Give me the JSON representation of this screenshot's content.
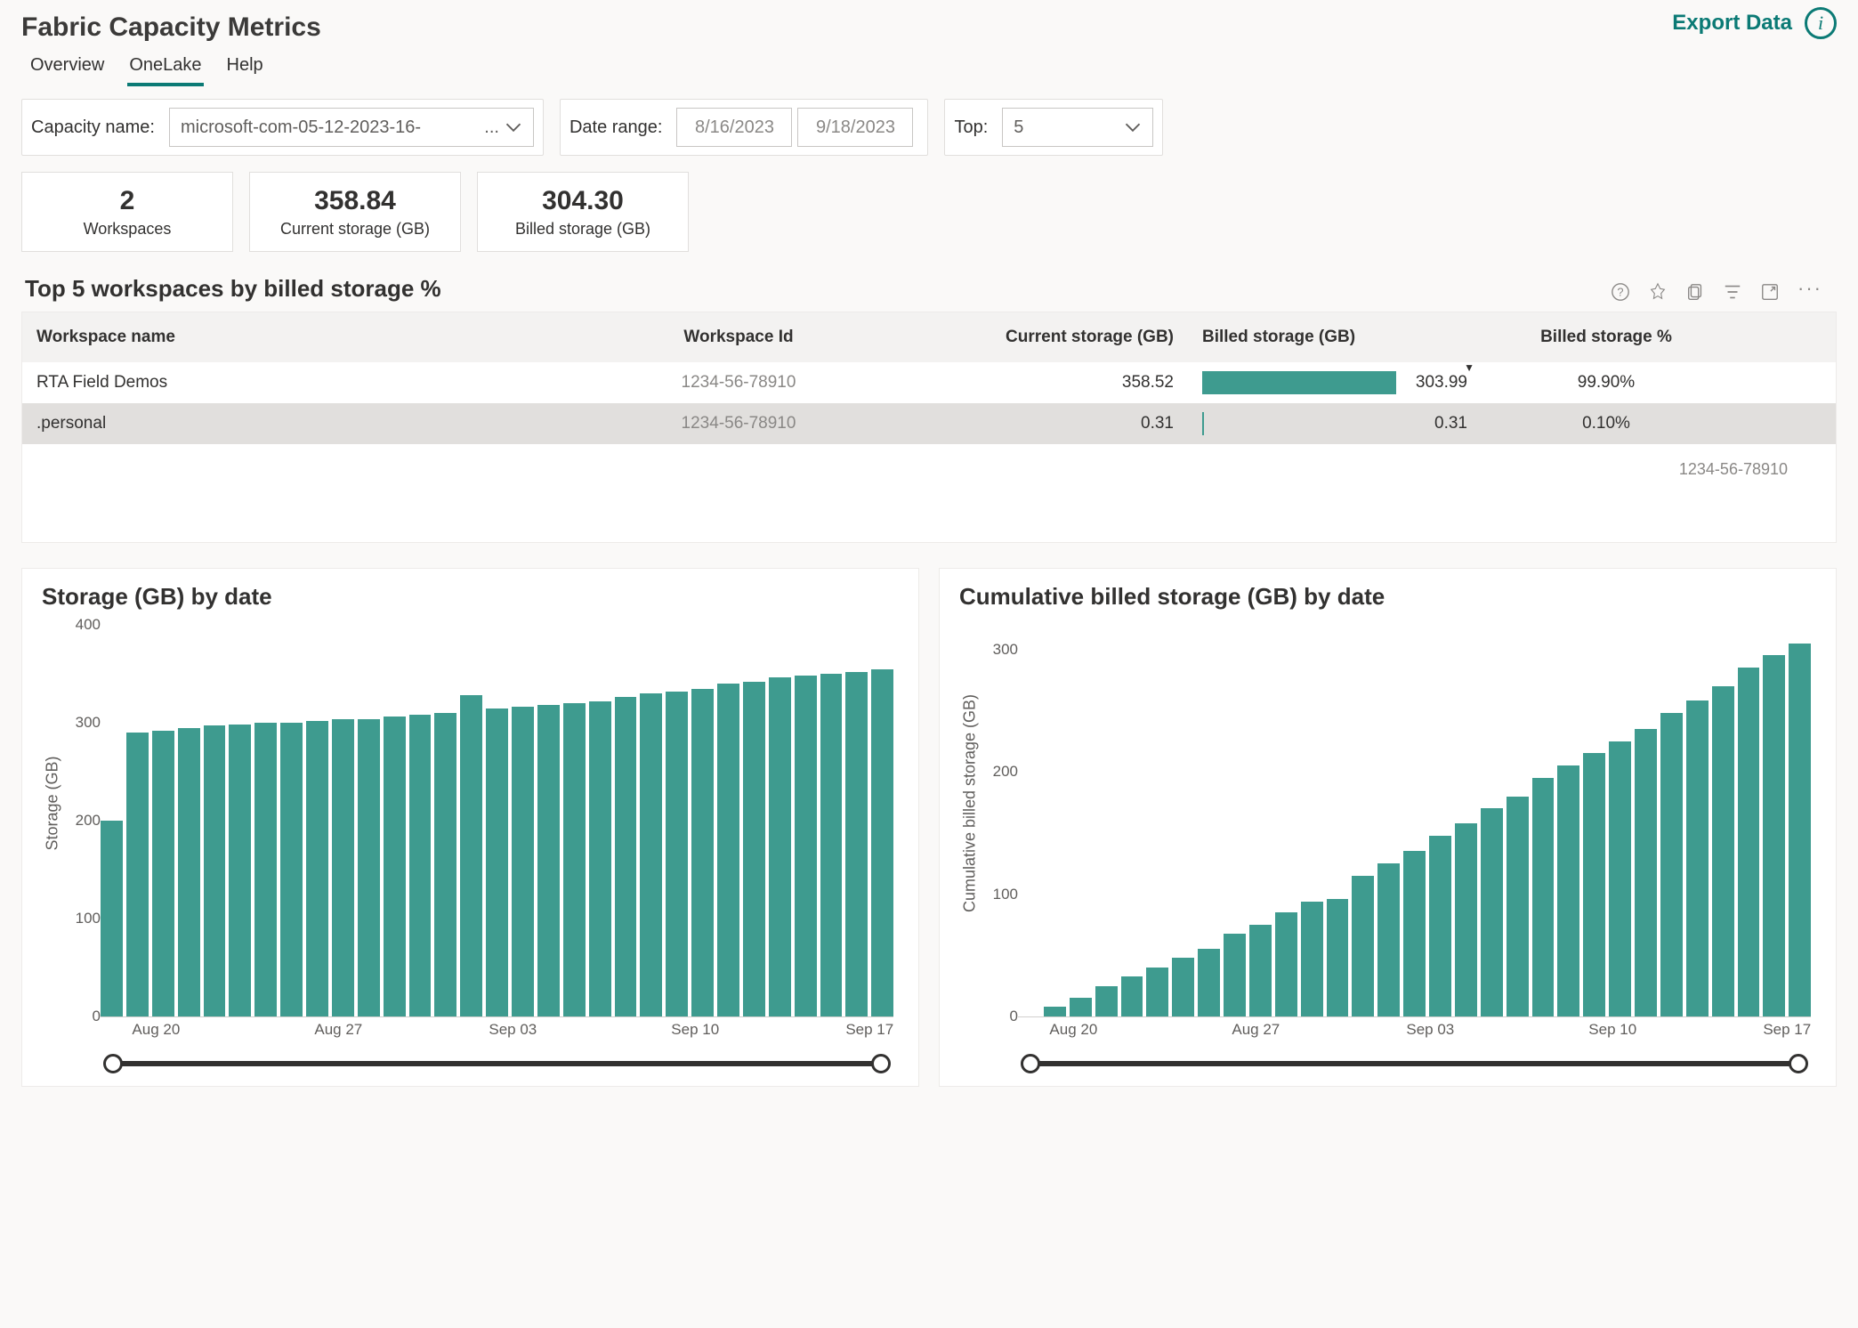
{
  "header": {
    "title": "Fabric Capacity Metrics",
    "export_label": "Export Data",
    "tabs": [
      "Overview",
      "OneLake",
      "Help"
    ],
    "active_tab": "OneLake"
  },
  "filters": {
    "capacity_label": "Capacity name:",
    "capacity_value": "microsoft-com-05-12-2023-16-",
    "capacity_suffix": "...",
    "date_label": "Date range:",
    "date_from": "8/16/2023",
    "date_to": "9/18/2023",
    "top_label": "Top:",
    "top_value": "5"
  },
  "kpis": [
    {
      "value": "2",
      "label": "Workspaces"
    },
    {
      "value": "358.84",
      "label": "Current storage (GB)"
    },
    {
      "value": "304.30",
      "label": "Billed storage (GB)"
    }
  ],
  "table": {
    "title": "Top 5 workspaces by billed storage %",
    "columns": [
      "Workspace name",
      "Workspace Id",
      "Current storage (GB)",
      "Billed storage (GB)",
      "Billed storage %"
    ],
    "rows": [
      {
        "name": "RTA Field Demos",
        "id": "1234-56-78910",
        "current": "358.52",
        "billed": "303.99",
        "billed_bar_pct": 100,
        "pct": "99.90%"
      },
      {
        "name": ".personal",
        "id": "1234-56-78910",
        "current": "0.31",
        "billed": "0.31",
        "billed_bar_pct": 1,
        "pct": "0.10%"
      }
    ],
    "footer_id": "1234-56-78910"
  },
  "chart_data": [
    {
      "type": "bar",
      "title": "Storage (GB) by date",
      "ylabel": "Storage (GB)",
      "ylim": [
        0,
        400
      ],
      "yticks": [
        0,
        100,
        200,
        300,
        400
      ],
      "categories": [
        "Aug 18",
        "Aug 19",
        "Aug 20",
        "Aug 21",
        "Aug 22",
        "Aug 23",
        "Aug 24",
        "Aug 25",
        "Aug 26",
        "Aug 27",
        "Aug 28",
        "Aug 29",
        "Aug 30",
        "Aug 31",
        "Sep 01",
        "Sep 02",
        "Sep 03",
        "Sep 04",
        "Sep 05",
        "Sep 06",
        "Sep 07",
        "Sep 08",
        "Sep 09",
        "Sep 10",
        "Sep 11",
        "Sep 12",
        "Sep 13",
        "Sep 14",
        "Sep 15",
        "Sep 16",
        "Sep 17"
      ],
      "values": [
        200,
        290,
        292,
        295,
        297,
        298,
        300,
        300,
        302,
        304,
        304,
        306,
        308,
        310,
        328,
        315,
        316,
        318,
        320,
        322,
        326,
        330,
        332,
        335,
        340,
        342,
        346,
        348,
        350,
        352,
        355
      ],
      "xticks": [
        {
          "label": "Aug 20",
          "pos_pct": 7
        },
        {
          "label": "Aug 27",
          "pos_pct": 30
        },
        {
          "label": "Sep 03",
          "pos_pct": 52
        },
        {
          "label": "Sep 10",
          "pos_pct": 75
        },
        {
          "label": "Sep 17",
          "pos_pct": 97
        }
      ]
    },
    {
      "type": "bar",
      "title": "Cumulative billed storage (GB) by date",
      "ylabel": "Cumulative billed storage (GB)",
      "ylim": [
        0,
        320
      ],
      "yticks": [
        0,
        100,
        200,
        300
      ],
      "categories": [
        "Aug 18",
        "Aug 19",
        "Aug 20",
        "Aug 21",
        "Aug 22",
        "Aug 23",
        "Aug 24",
        "Aug 25",
        "Aug 26",
        "Aug 27",
        "Aug 28",
        "Aug 29",
        "Aug 30",
        "Aug 31",
        "Sep 01",
        "Sep 02",
        "Sep 03",
        "Sep 04",
        "Sep 05",
        "Sep 06",
        "Sep 07",
        "Sep 08",
        "Sep 09",
        "Sep 10",
        "Sep 11",
        "Sep 12",
        "Sep 13",
        "Sep 14",
        "Sep 15",
        "Sep 16",
        "Sep 17"
      ],
      "values": [
        0,
        8,
        15,
        25,
        33,
        40,
        48,
        55,
        68,
        75,
        85,
        94,
        96,
        115,
        125,
        135,
        148,
        158,
        170,
        180,
        195,
        205,
        215,
        225,
        235,
        248,
        258,
        270,
        285,
        295,
        305
      ],
      "xticks": [
        {
          "label": "Aug 20",
          "pos_pct": 7
        },
        {
          "label": "Aug 27",
          "pos_pct": 30
        },
        {
          "label": "Sep 03",
          "pos_pct": 52
        },
        {
          "label": "Sep 10",
          "pos_pct": 75
        },
        {
          "label": "Sep 17",
          "pos_pct": 97
        }
      ]
    }
  ]
}
